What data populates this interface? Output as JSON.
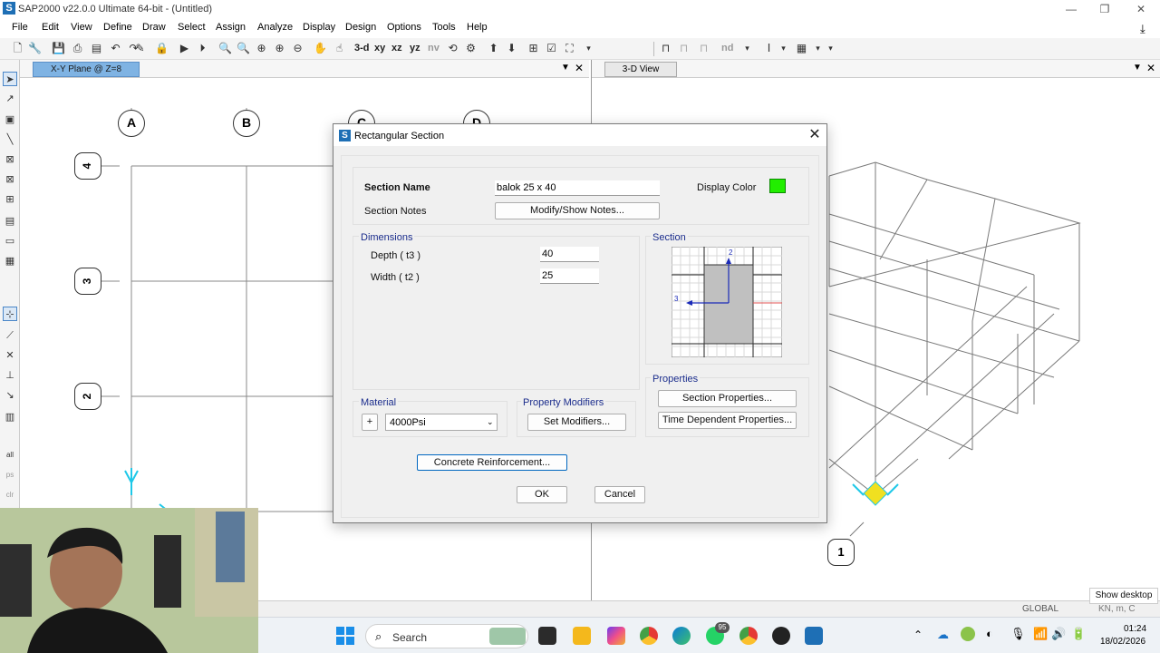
{
  "app": {
    "title": "SAP2000 v22.0.0 Ultimate 64-bit - (Untitled)",
    "logo_letter": "S",
    "window_controls": [
      "—",
      "❐",
      "✕"
    ]
  },
  "menu": [
    "File",
    "Edit",
    "View",
    "Define",
    "Draw",
    "Select",
    "Assign",
    "Analyze",
    "Display",
    "Design",
    "Options",
    "Tools",
    "Help"
  ],
  "toolbar": {
    "view_buttons": [
      "3-d",
      "xy",
      "xz",
      "yz",
      "nv"
    ],
    "nd_label": "nd"
  },
  "left_view": {
    "tab_label": "X-Y Plane @ Z=8",
    "grid_x": [
      "A",
      "B",
      "C",
      "D"
    ],
    "grid_y": [
      "4",
      "3",
      "2"
    ]
  },
  "right_view": {
    "tab_label": "3-D View",
    "grid_bubble": "1"
  },
  "status": {
    "coord_system": "GLOBAL",
    "units": "KN, m, C",
    "show_desktop": "Show desktop"
  },
  "taskbar": {
    "search_placeholder": "Search",
    "badge_count": "95",
    "time": "01:24",
    "date": "18/02/2026"
  },
  "dialog": {
    "title": "Rectangular Section",
    "section_name_label": "Section Name",
    "section_name_value": "balok 25 x 40",
    "section_notes_label": "Section Notes",
    "modify_notes_button": "Modify/Show Notes...",
    "display_color_label": "Display Color",
    "display_color": "#22ee00",
    "dimensions_title": "Dimensions",
    "depth_label": "Depth  ( t3 )",
    "depth_value": "40",
    "width_label": "Width  ( t2 )",
    "width_value": "25",
    "section_title": "Section",
    "axis_2": "2",
    "axis_3": "3",
    "properties_title": "Properties",
    "section_properties_button": "Section Properties...",
    "time_dependent_button": "Time Dependent Properties...",
    "material_title": "Material",
    "material_plus": "+",
    "material_value": "4000Psi",
    "property_modifiers_title": "Property Modifiers",
    "set_modifiers_button": "Set Modifiers...",
    "concrete_reinforcement_button": "Concrete Reinforcement...",
    "ok_button": "OK",
    "cancel_button": "Cancel"
  }
}
